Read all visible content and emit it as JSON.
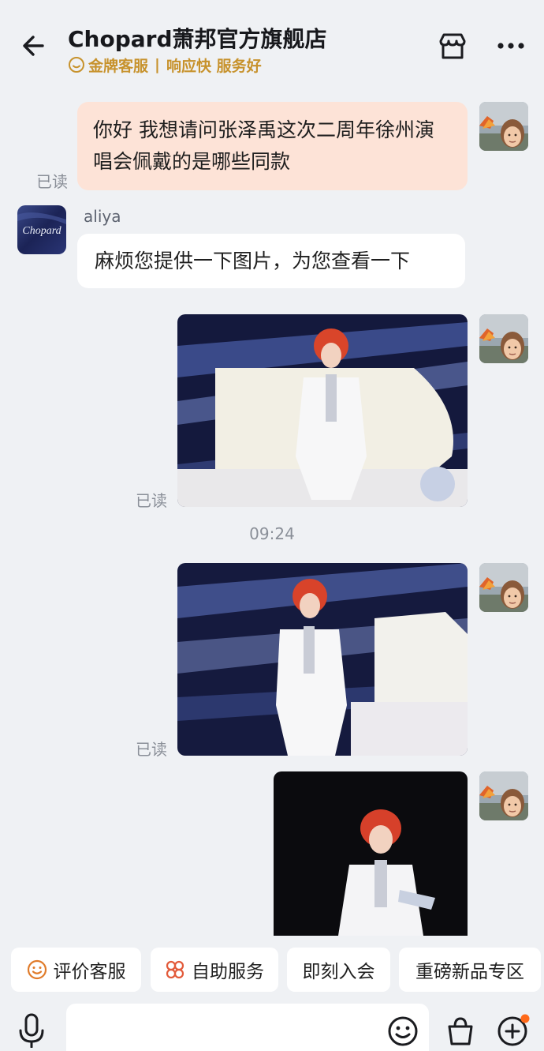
{
  "header": {
    "shop_name": "Chopard萧邦官方旗舰店",
    "badge_text": "金牌客服",
    "separator": "|",
    "service_tags": "响应快 服务好",
    "accent_color": "#c7922c"
  },
  "messages": {
    "outgoing_text": "你好 我想请问张泽禹这次二周年徐州演唱会佩戴的是哪些同款",
    "agent_name": "aliya",
    "incoming_text": "麻烦您提供一下图片，为您查看一下",
    "read_label": "已读",
    "timestamp": "09:24",
    "shop_logo_text": "Chopard",
    "outgoing_bubble_color": "#fde3d7"
  },
  "quick_actions": [
    {
      "label": "评价客服",
      "icon": "smile-icon"
    },
    {
      "label": "自助服务",
      "icon": "grid-flower-icon"
    },
    {
      "label": "即刻入会",
      "icon": ""
    },
    {
      "label": "重磅新品专区",
      "icon": ""
    }
  ],
  "input_bar": {
    "value": "",
    "icons": [
      "mic-icon",
      "emoji-icon",
      "shopping-bag-icon",
      "plus-icon"
    ]
  }
}
